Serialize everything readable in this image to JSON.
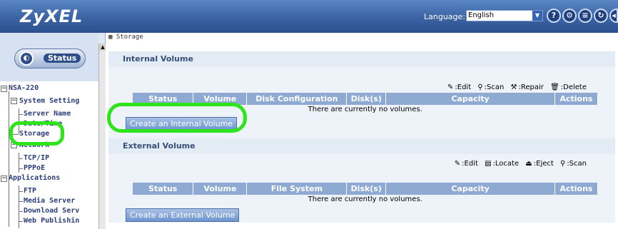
{
  "header": {
    "logo": "ZyXEL",
    "language_label": "Language:",
    "language_value": "English",
    "icons": [
      "help-icon",
      "wizard-icon",
      "document-icon",
      "refresh-icon",
      "logout-icon"
    ],
    "icon_glyphs": [
      "?",
      "⚙",
      "≡",
      "↻",
      "◂"
    ]
  },
  "sidebar": {
    "status_label": "Status",
    "tree": {
      "root": "NSA-220",
      "system_setting": "System Setting",
      "server_name": "Server Name",
      "date_time": "Date/Time",
      "storage": "Storage",
      "network": "Network",
      "tcpip": "TCP/IP",
      "pppoe": "PPPoE",
      "applications": "Applications",
      "ftp": "FTP",
      "media_server": "Media Server",
      "download_serv": "Download Serv",
      "web_publishing": "Web Publishin"
    }
  },
  "content": {
    "breadcrumb": "Storage",
    "internal": {
      "title": "Internal Volume",
      "legend": {
        "edit": ":Edit",
        "scan": ":Scan",
        "repair": ":Repair",
        "delete": ":Delete"
      },
      "columns": [
        "Status",
        "Volume",
        "Disk Configuration",
        "Disk(s)",
        "Capacity",
        "Actions"
      ],
      "empty_message": "There are currently no volumes.",
      "create_button": "Create an Internal Volume"
    },
    "external": {
      "title": "External Volume",
      "legend": {
        "edit": ":Edit",
        "locate": ":Locate",
        "eject": ":Eject",
        "scan": ":Scan"
      },
      "columns": [
        "Status",
        "Volume",
        "File System",
        "Disk(s)",
        "Capacity",
        "Actions"
      ],
      "empty_message": "There are currently no volumes.",
      "create_button": "Create an External Volume"
    }
  },
  "colors": {
    "header_blue": "#3b63a3",
    "table_header": "#8faad2",
    "highlight_green": "#2ee41a"
  }
}
